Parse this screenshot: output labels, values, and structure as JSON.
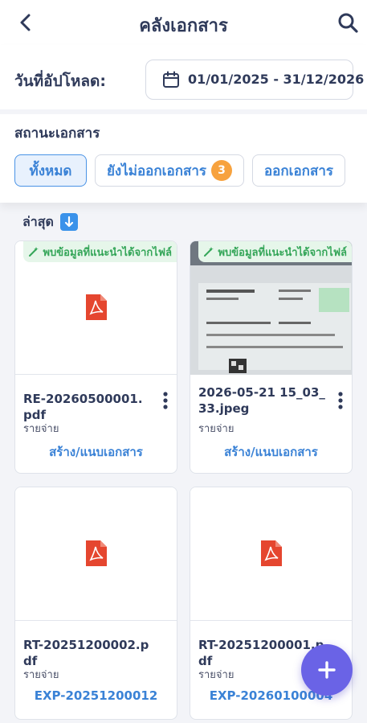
{
  "header": {
    "title": "คลังเอกสาร"
  },
  "filters": {
    "upload_label": "วันที่อัปโหลด:",
    "date_range": "01/01/2025 - 31/12/2026",
    "status_label": "สถานะเอกสาร",
    "chips": [
      {
        "label": "ทั้งหมด",
        "active": true
      },
      {
        "label": "ยังไม่ออกเอกสาร",
        "badge": "3",
        "active": false
      },
      {
        "label": "ออกเอกสาร",
        "active": false
      }
    ]
  },
  "sort": {
    "label": "ล่าสุด",
    "direction_icon": "arrow-down-icon"
  },
  "documents": [
    {
      "suggest_tag": "พบข้อมูลที่แนะนำได้จากไฟล์",
      "name": "RE-20260500001.pdf",
      "category": "รายจ่าย",
      "action": "สร้าง/แนบเอกสาร",
      "thumbnail": "pdf-icon"
    },
    {
      "suggest_tag": "พบข้อมูลที่แนะนำได้จากไฟล์",
      "name": "2026-05-21 15_03_33.jpeg",
      "category": "รายจ่าย",
      "action": "สร้าง/แนบเอกสาร",
      "thumbnail": "photo"
    },
    {
      "name": "RT-20251200002.pdf",
      "category": "รายจ่าย",
      "action": "EXP-20251200012",
      "thumbnail": "pdf-icon"
    },
    {
      "name": "RT-20251200001.pdf",
      "category": "รายจ่าย",
      "action": "EXP-20260100004",
      "thumbnail": "pdf-icon"
    }
  ],
  "colors": {
    "accent": "#3a82d6",
    "badge": "#f7a23e",
    "suggest_bg": "#e6f6ea",
    "suggest_text": "#35a659",
    "pdf": "#e5462f",
    "fab": "#6a63e6"
  }
}
